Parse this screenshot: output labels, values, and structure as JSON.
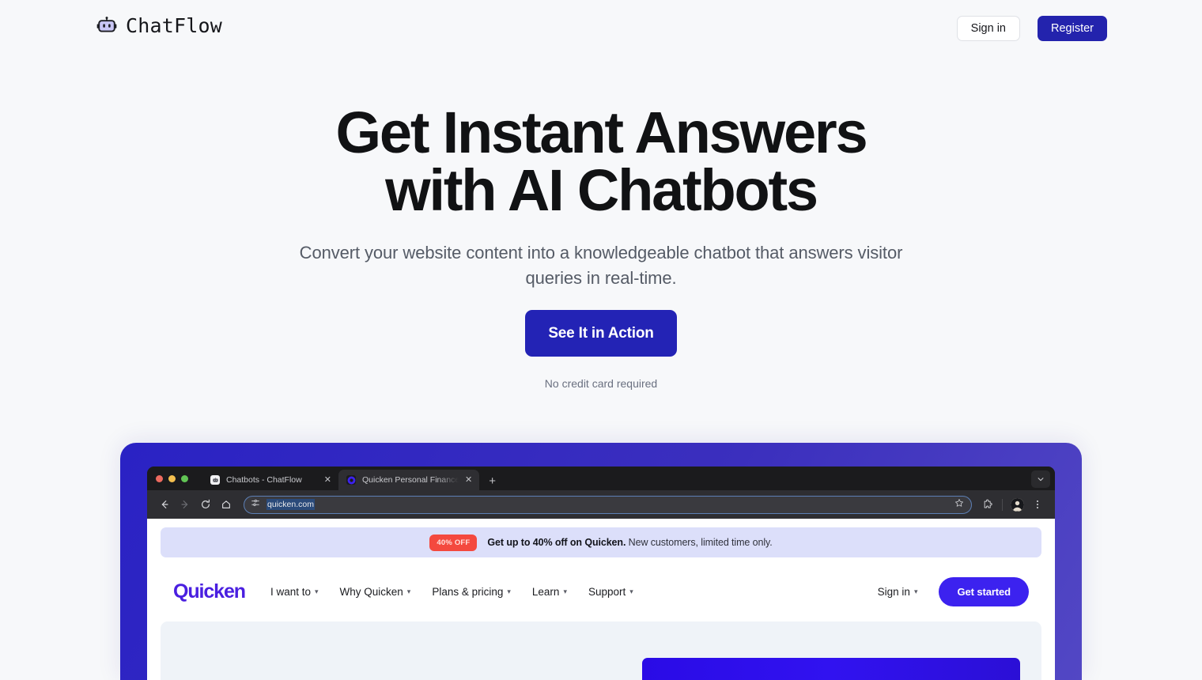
{
  "header": {
    "brand": {
      "name": "ChatFlow",
      "icon": "robot-icon"
    },
    "sign_in_label": "Sign in",
    "register_label": "Register"
  },
  "hero": {
    "title_line1": "Get Instant Answers",
    "title_line2": "with AI Chatbots",
    "subtitle": "Convert your website content into a knowledgeable chatbot that answers visitor queries in real-time.",
    "cta_label": "See It in Action",
    "note": "No credit card required"
  },
  "mockup": {
    "browser": {
      "tabs": [
        {
          "title": "Chatbots - ChatFlow",
          "favicon": "robot-icon",
          "active": false,
          "close": "✕"
        },
        {
          "title": "Quicken Personal Finance and",
          "favicon": "quicken-icon",
          "active": true,
          "close": "✕"
        }
      ],
      "new_tab_label": "+",
      "toolbar": {
        "back_icon": "arrow-left-icon",
        "forward_icon": "arrow-right-icon",
        "reload_icon": "reload-icon",
        "home_icon": "home-icon",
        "site_settings_icon": "tune-icon",
        "url": "quicken.com",
        "bookmark_icon": "star-icon",
        "extensions_icon": "puzzle-icon",
        "profile_icon": "avatar-icon",
        "menu_icon": "kebab-menu-icon"
      },
      "tabstrip_menu_icon": "chevron-down-icon"
    },
    "page": {
      "promo": {
        "badge": "40% OFF",
        "text_bold": "Get up to 40% off on Quicken.",
        "text_rest": " New customers, limited time only."
      },
      "nav": {
        "logo": "Quicken",
        "items": [
          {
            "label": "I want to"
          },
          {
            "label": "Why Quicken"
          },
          {
            "label": "Plans & pricing"
          },
          {
            "label": "Learn"
          },
          {
            "label": "Support"
          }
        ],
        "sign_in_label": "Sign in",
        "get_started_label": "Get started"
      }
    }
  },
  "colors": {
    "page_bg": "#f7f8fa",
    "brand_blue": "#2323ad",
    "cta_blue": "#2323b5",
    "frame_blue": "#2a22c4",
    "quicken_purple": "#4a1fe0",
    "promo_red": "#f4493e",
    "promo_bg": "#dcdffa"
  }
}
